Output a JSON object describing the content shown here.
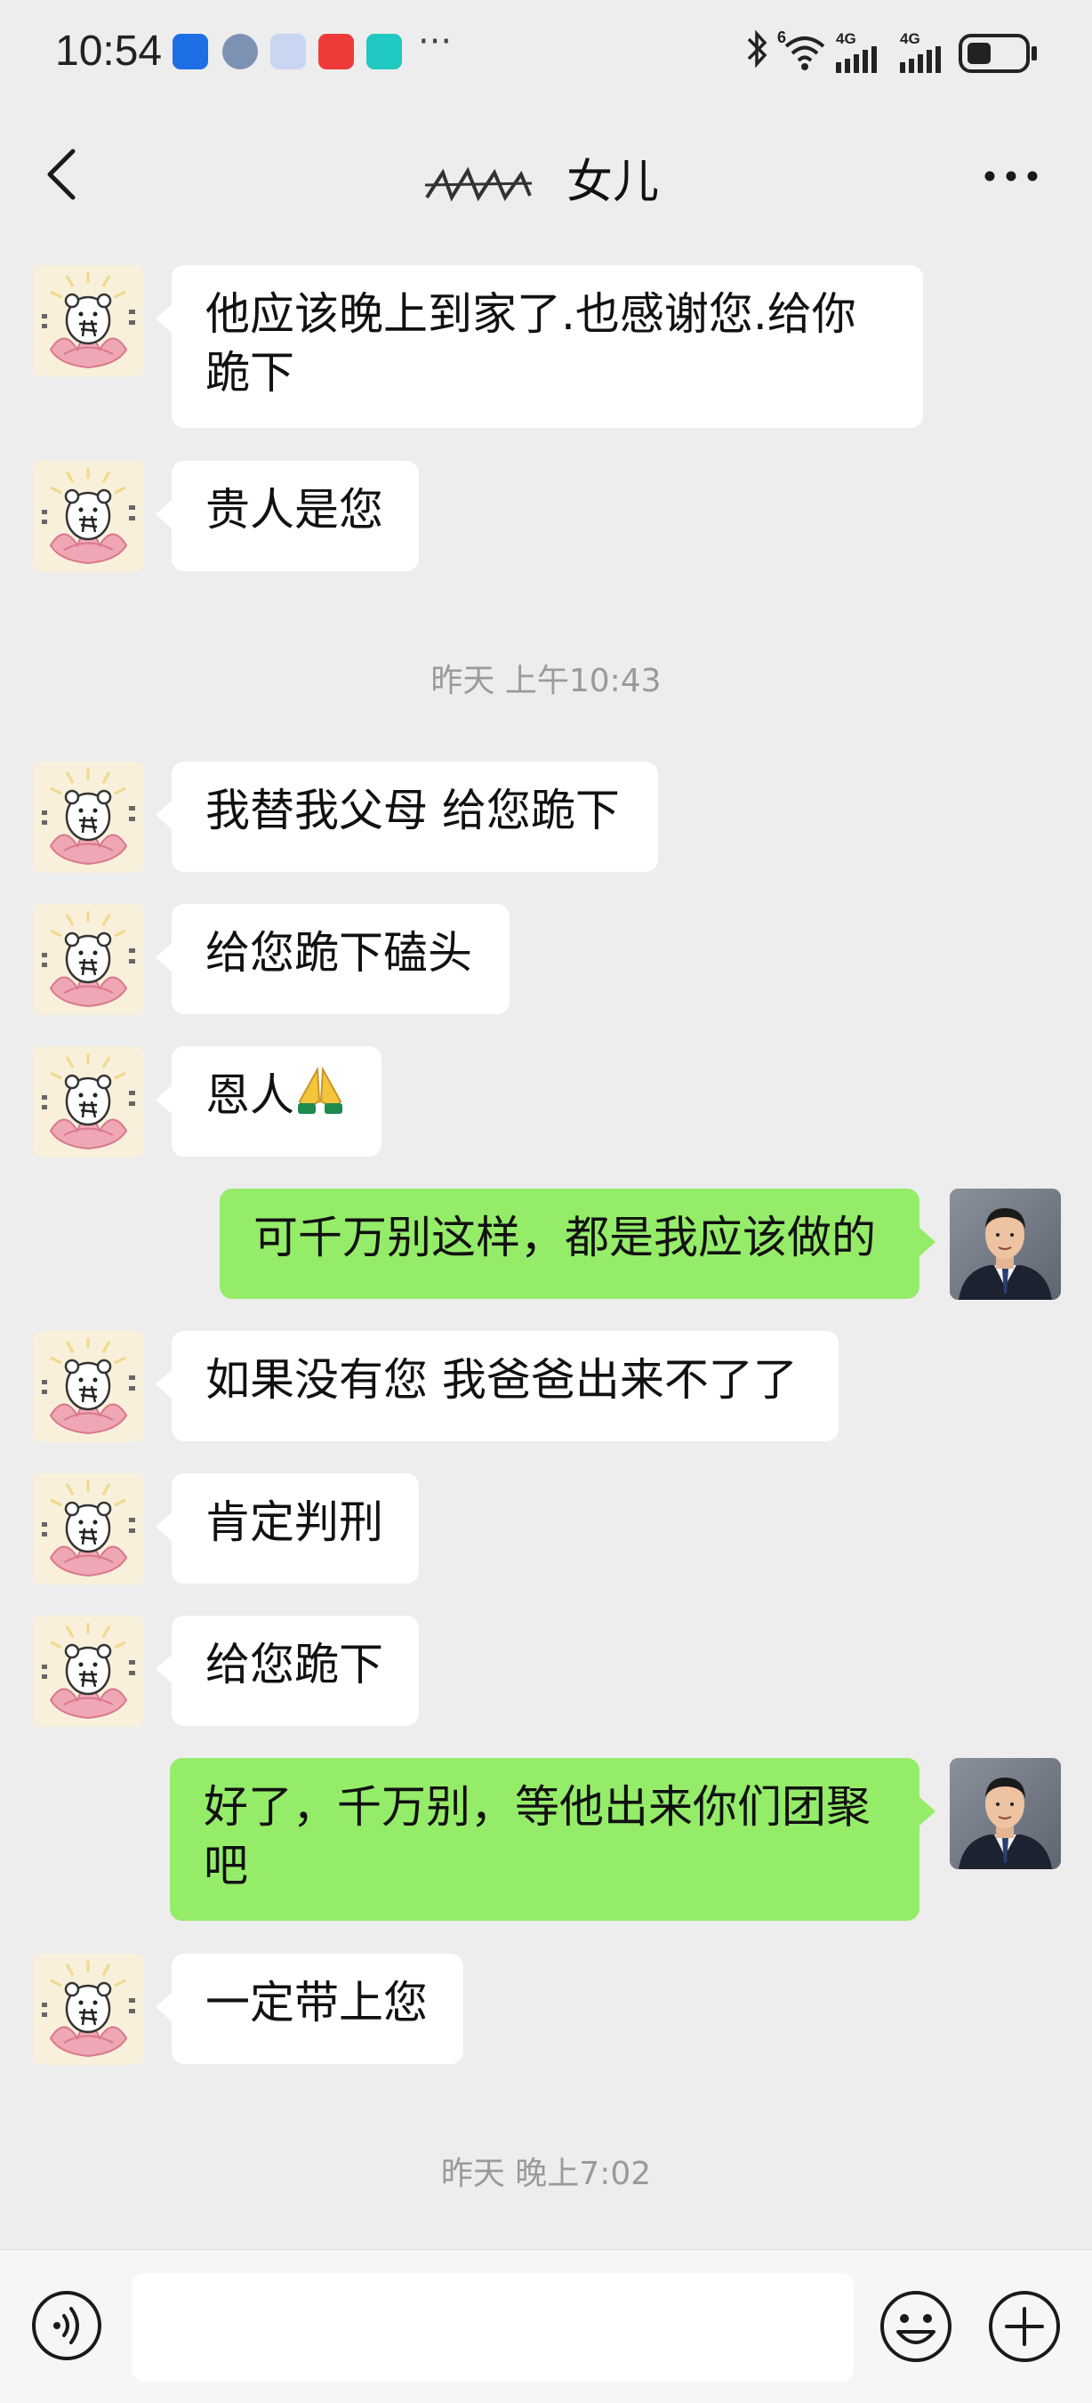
{
  "status_bar": {
    "time": "10:54",
    "network_1": "4G",
    "network_2": "4G",
    "signal_superscript": "6",
    "more_indicator": "···"
  },
  "header": {
    "title": "女儿",
    "back_icon": "chevron-left-icon",
    "more_icon": "more-dots-icon"
  },
  "messages": [
    {
      "side": "other",
      "text": "他应该晚上到家了.也感谢您.给你跪下"
    },
    {
      "side": "other",
      "text": "贵人是您"
    },
    {
      "type": "timestamp",
      "text": "昨天 上午10:43"
    },
    {
      "side": "other",
      "text": "我替我父母 给您跪下"
    },
    {
      "side": "other",
      "text": "给您跪下磕头"
    },
    {
      "side": "other",
      "text": "恩人",
      "emoji": "folded-hands"
    },
    {
      "side": "self",
      "text": "可千万别这样，都是我应该做的"
    },
    {
      "side": "other",
      "text": "如果没有您 我爸爸出来不了了"
    },
    {
      "side": "other",
      "text": "肯定判刑"
    },
    {
      "side": "other",
      "text": "给您跪下"
    },
    {
      "side": "self",
      "text": "好了，千万别，等他出来你们团聚吧"
    },
    {
      "side": "other",
      "text": "一定带上您"
    },
    {
      "type": "timestamp",
      "text": "昨天 晚上7:02"
    }
  ],
  "input_bar": {
    "voice_icon": "voice-icon",
    "emoji_icon": "emoji-icon",
    "plus_icon": "plus-icon",
    "input_value": ""
  },
  "colors": {
    "background": "#EDEDED",
    "self_bubble": "#95EC69",
    "other_bubble": "#FFFFFF",
    "timestamp_text": "#9A9A9A"
  }
}
